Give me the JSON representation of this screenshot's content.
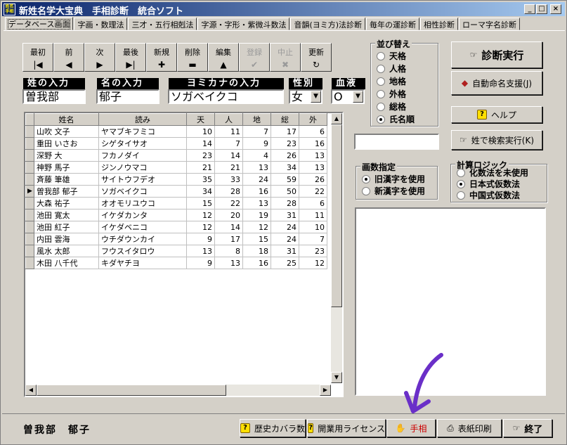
{
  "title": {
    "icon_text": "姓名手相",
    "text": "新姓名学大宝典　手相診断　統合ソフト",
    "min_symbol": "_",
    "max_symbol": "□",
    "close_symbol": "×"
  },
  "tabs": [
    "データベース画面",
    "字画・数理法",
    "三才・五行相剋法",
    "字源・字形・紫微斗数法",
    "音韻(ヨミ方)法診断",
    "毎年の運診断",
    "相性診断",
    "ローマ字名診断"
  ],
  "nav": {
    "first": "最初",
    "prev": "前",
    "next": "次",
    "last": "最後",
    "new": "新規",
    "delete": "削除",
    "edit": "編集",
    "save": "登録",
    "cancel": "中止",
    "refresh": "更新"
  },
  "inputs": {
    "surname_label": "姓の入力",
    "surname_value": "曽我部",
    "given_label": "名の入力",
    "given_value": "郁子",
    "kana_label": "ヨミカナの入力",
    "kana_value": "ソガベイクコ",
    "gender_label": "性別",
    "gender_value": "女",
    "blood_label": "血液",
    "blood_value": "O"
  },
  "grid": {
    "headers": [
      "姓名",
      "読み",
      "天",
      "人",
      "地",
      "総",
      "外"
    ],
    "rows": [
      [
        "山吹 文子",
        "ヤマブキフミコ",
        "10",
        "11",
        "7",
        "17",
        "6"
      ],
      [
        "重田 いさお",
        "シゲタイサオ",
        "14",
        "7",
        "9",
        "23",
        "16"
      ],
      [
        "深野 大",
        "フカノダイ",
        "23",
        "14",
        "4",
        "26",
        "13"
      ],
      [
        "神野 馬子",
        "ジンノウマコ",
        "21",
        "21",
        "13",
        "34",
        "13"
      ],
      [
        "斉藤 筆雄",
        "サイトウフデオ",
        "35",
        "33",
        "24",
        "59",
        "26"
      ],
      [
        "曽我部 郁子",
        "ソガベイクコ",
        "34",
        "28",
        "16",
        "50",
        "22"
      ],
      [
        "大森 祐子",
        "オオモリユウコ",
        "15",
        "22",
        "13",
        "28",
        "6"
      ],
      [
        "池田 寛太",
        "イケダカンタ",
        "12",
        "20",
        "19",
        "31",
        "11"
      ],
      [
        "池田 紅子",
        "イケダベニコ",
        "12",
        "14",
        "12",
        "24",
        "10"
      ],
      [
        "内田 雲海",
        "ウチダウンカイ",
        "9",
        "17",
        "15",
        "24",
        "7"
      ],
      [
        "風水 太郎",
        "フウスイタロウ",
        "13",
        "8",
        "18",
        "31",
        "23"
      ],
      [
        "木田 八千代",
        "キダヤチヨ",
        "9",
        "13",
        "16",
        "25",
        "12"
      ]
    ],
    "current_row": 5
  },
  "sort": {
    "title": "並び替え",
    "options": [
      "天格",
      "人格",
      "地格",
      "外格",
      "総格",
      "氏名順"
    ],
    "selected": 5
  },
  "kanji": {
    "title": "画数指定",
    "options": [
      "旧漢字を使用",
      "新漢字を使用"
    ],
    "selected": 0
  },
  "logic": {
    "title": "計算ロジック",
    "options": [
      "化数法を未使用",
      "日本式仮数法",
      "中国式仮数法"
    ],
    "selected": 1
  },
  "buttons": {
    "diagnose": "診断実行",
    "auto_naming": "自動命名支援(J)",
    "help": "ヘルプ",
    "surname_search": "姓で検索実行(K)",
    "history": "歴史カバラ数",
    "license": "開業用ライセンス",
    "palm": "手相",
    "print": "表紙印刷",
    "exit": "終了"
  },
  "footer": {
    "name": "曽我部　郁子"
  },
  "colors": {
    "face": "#d4d0c8",
    "title_start": "#0a246a",
    "palm_text": "#cc0000",
    "annotation_arrow": "#6a2fc8"
  }
}
